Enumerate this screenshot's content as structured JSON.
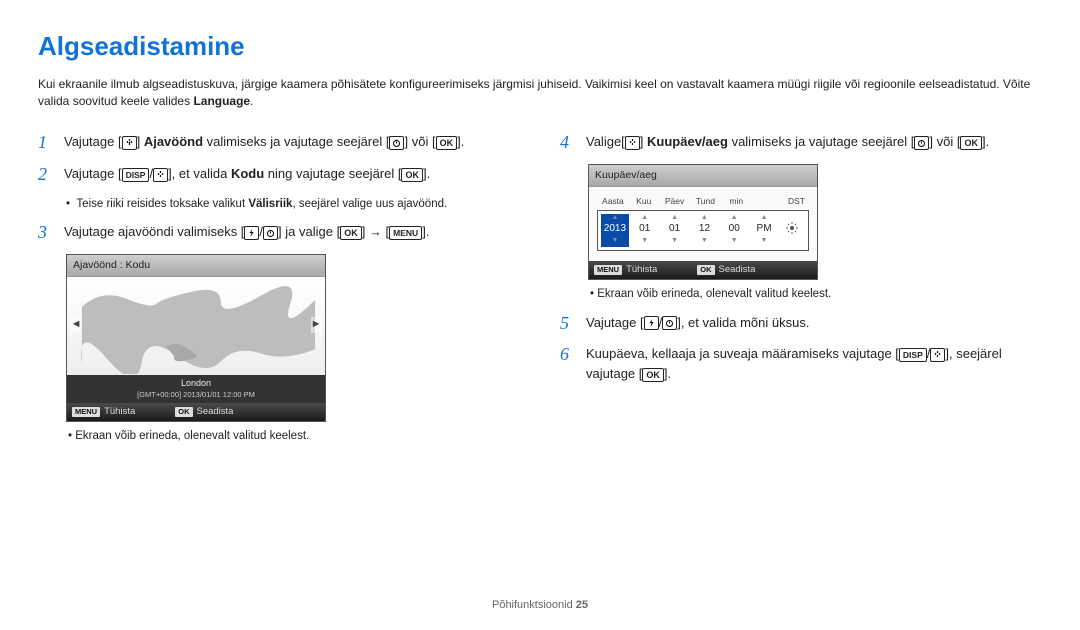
{
  "title": "Algseadistamine",
  "intro_a": "Kui ekraanile ilmub algseadistuskuva, järgige kaamera põhisätete konfigureerimiseks järgmisi juhiseid. Vaikimisi keel on vastavalt kaamera müügi riigile või regioonile eelseadistatud. Võite valida soovitud keele valides ",
  "intro_b": "Language",
  "intro_c": ".",
  "left": {
    "s1_a": "Vajutage [",
    "s1_b": "] ",
    "s1_bold": "Ajavöönd",
    "s1_c": " valimiseks ja vajutage seejärel [",
    "s1_d": "] või [",
    "s1_e": "].",
    "s2_a": "Vajutage [",
    "s2_b": "/",
    "s2_c": "], et valida ",
    "s2_bold": "Kodu",
    "s2_d": " ning vajutage seejärel [",
    "s2_e": "].",
    "s2_note_a": "Teise riiki reisides toksake valikut ",
    "s2_note_b": "Välisriik",
    "s2_note_c": ", seejärel valige uus ajavöönd.",
    "s3_a": "Vajutage ajavööndi valimiseks [",
    "s3_b": "/",
    "s3_c": "] ja valige [",
    "s3_d": "] → [",
    "s3_e": "].",
    "screen1": {
      "head": "Ajavöönd : Kodu",
      "city": "London",
      "tz": "[GMT+00:00] 2013/01/01 12:00 PM",
      "menu": "MENU",
      "cancel": "Tühista",
      "ok": "OK",
      "set": "Seadista"
    },
    "bullet": "Ekraan võib erineda, olenevalt valitud keelest."
  },
  "right": {
    "s4_a": "Valige[",
    "s4_b": "] ",
    "s4_bold": "Kuupäev/aeg",
    "s4_c": " valimiseks ja vajutage seejärel [",
    "s4_d": "] või [",
    "s4_e": "].",
    "screen2": {
      "head": "Kuupäev/aeg",
      "labels": {
        "y": "Aasta",
        "mo": "Kuu",
        "d": "Päev",
        "h": "Tund",
        "mi": "min",
        "dst": "DST"
      },
      "vals": {
        "y": "2013",
        "mo": "01",
        "d": "01",
        "h": "12",
        "mi": "00",
        "ap": "PM"
      },
      "menu": "MENU",
      "cancel": "Tühista",
      "ok": "OK",
      "set": "Seadista"
    },
    "bullet": "Ekraan võib erineda, olenevalt valitud keelest.",
    "s5_a": "Vajutage [",
    "s5_b": "/",
    "s5_c": "], et valida mõni üksus.",
    "s6_a": "Kuupäeva, kellaaja ja suveaja määramiseks vajutage [",
    "s6_b": "/",
    "s6_c": "], seejärel vajutage [",
    "s6_d": "]."
  },
  "footer_a": "Põhifunktsioonid ",
  "footer_b": "25"
}
